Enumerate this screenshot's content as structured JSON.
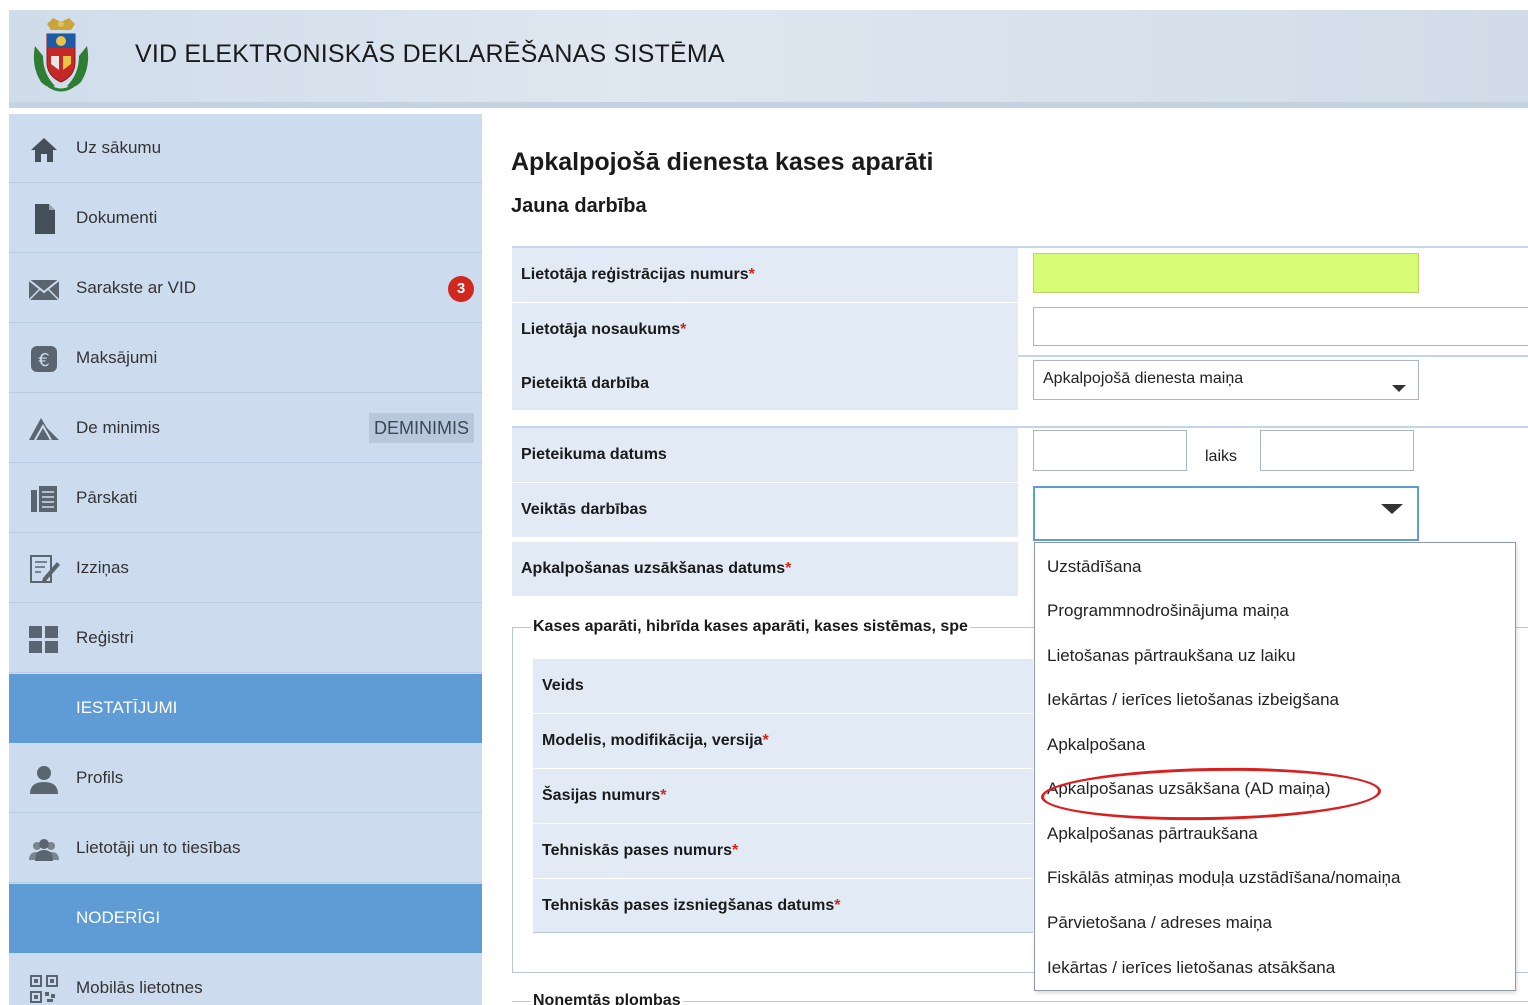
{
  "header": {
    "title": "VID ELEKTRONISKĀS DEKLARĒŠANAS SISTĒMA",
    "logo_icon": "latvia-coat-of-arms-icon"
  },
  "sidebar": {
    "items": [
      {
        "label": "Uz sākumu",
        "icon": "home-icon"
      },
      {
        "label": "Dokumenti",
        "icon": "document-icon"
      },
      {
        "label": "Sarakste ar VID",
        "icon": "envelope-icon",
        "badge": "3"
      },
      {
        "label": "Maksājumi",
        "icon": "euro-icon"
      },
      {
        "label": "De minimis",
        "icon": "de-minimis-icon",
        "tag": "DEMINIMIS"
      },
      {
        "label": "Pārskati",
        "icon": "reports-icon"
      },
      {
        "label": "Izziņas",
        "icon": "certificate-edit-icon"
      },
      {
        "label": "Reģistri",
        "icon": "grid-icon"
      }
    ],
    "section_settings": "IESTATĪJUMI",
    "settings_items": [
      {
        "label": "Profils",
        "icon": "user-icon"
      },
      {
        "label": "Lietotāji un to tiesības",
        "icon": "users-icon"
      }
    ],
    "section_useful": "NODERĪGI",
    "useful_items": [
      {
        "label": "Mobilās lietotnes",
        "icon": "qr-code-icon"
      }
    ]
  },
  "main": {
    "title": "Apkalpojošā dienesta kases aparāti",
    "subtitle": "Jauna darbība",
    "form": {
      "user_reg_number_label": "Lietotāja reģistrācijas numurs",
      "user_name_label": "Lietotāja nosaukums",
      "requested_action_label": "Pieteiktā darbība",
      "requested_action_value": "Apkalpojošā dienesta maiņa",
      "application_date_label": "Pieteikuma datums",
      "time_label": "laiks",
      "performed_actions_label": "Veiktās darbības",
      "service_start_date_label": "Apkalpošanas uzsākšanas datums",
      "required_mark": "*"
    },
    "devices_fieldset": {
      "legend": "Kases aparāti, hibrīda kases aparāti, kases sistēmas, spe",
      "type_label": "Veids",
      "model_label": "Modelis, modifikācija, versija",
      "chassis_label": "Šasijas numurs",
      "passport_number_label": "Tehniskās pases numurs",
      "passport_date_label": "Tehniskās pases izsniegšanas datums"
    },
    "seals_fieldset": {
      "legend": "Noņemtās plombas"
    },
    "dropdown_options": [
      "Uzstādīšana",
      "Programmnodrošinājuma maiņa",
      "Lietošanas pārtraukšana uz laiku",
      "Iekārtas / ierīces lietošanas izbeigšana",
      "Apkalpošana",
      "Apkalpošanas uzsākšana (AD maiņa)",
      "Apkalpošanas pārtraukšana",
      "Fiskālās atmiņas moduļa uzstādīšana/nomaiņa",
      "Pārvietošana / adreses maiņa",
      "Iekārtas / ierīces lietošanas atsākšana"
    ]
  },
  "colors": {
    "accent": "#5f9bd5",
    "sidebar": "#ccdbee",
    "highlight": "#d82020",
    "required": "#d0271f",
    "input_highlight": "#d8fb74"
  }
}
